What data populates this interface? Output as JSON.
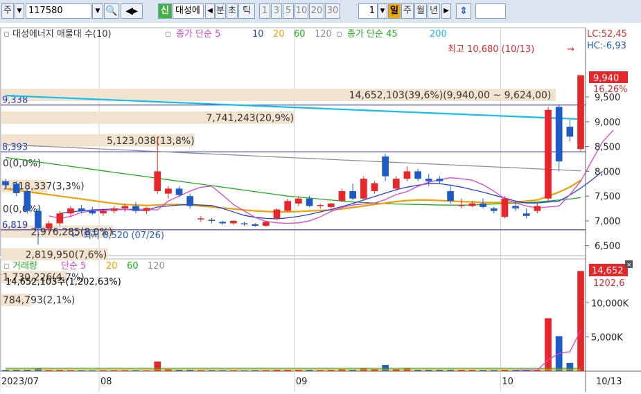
{
  "toolbar": {
    "mode_label": "주",
    "code_value": "117580",
    "new_badge": "신",
    "stock_name": "대성에",
    "period_tick": "분",
    "period_second": "초",
    "period_tick2": "틱",
    "numbers": [
      "1",
      "3",
      "5",
      "10",
      "20",
      "30"
    ],
    "interval_value": "1",
    "day_label": "일",
    "week_label": "주",
    "month_label": "월",
    "year_label": "년"
  },
  "price_panel": {
    "legend_title": "대성에너지 매물대 수(10)",
    "legend_ma1_label": "종가 단순 5",
    "legend_ma1_periods": [
      "10",
      "20",
      "60",
      "120"
    ],
    "legend_ma2_label": "종가 단순 45",
    "legend_ma2_period": "200",
    "right_label_lc": "LC:52,45",
    "right_label_hc": "HC:-6,93",
    "current_price": "9,940",
    "current_change": "16,26%",
    "high_annotation": "최고 10,680 (10/13)",
    "low_annotation": "최저 6,520 (07/26)",
    "left_levels": [
      "9,338",
      "8,393",
      "6,819"
    ],
    "volume_profile": [
      {
        "label": "14,652,103(39,6%)(9,940,00 ~ 9,624,00)",
        "value": 14652103,
        "pct": 39.6
      },
      {
        "label": "7,741,243(20,9%)",
        "value": 7741243,
        "pct": 20.9
      },
      {
        "label": "5,123,038(13,8%)",
        "value": 5123038,
        "pct": 13.8
      },
      {
        "label": "0(0,0%)",
        "value": 0,
        "pct": 0.0
      },
      {
        "label": "1,218,337(3,3%)",
        "value": 1218337,
        "pct": 3.3
      },
      {
        "label": "0(0,0%)",
        "value": 0,
        "pct": 0.0
      },
      {
        "label": "2,976,285(8,0%)",
        "value": 2976285,
        "pct": 8.0
      },
      {
        "label": "2,819,950(7,6%)",
        "value": 2819950,
        "pct": 7.6
      },
      {
        "label": "1,730,226(4,7%)",
        "value": 1730226,
        "pct": 4.7
      },
      {
        "label": "784,793(2,1%)",
        "value": 784793,
        "pct": 2.1
      }
    ]
  },
  "volume_panel": {
    "legend_title": "거래량",
    "legend_ma_label": "단순 5",
    "legend_ma_periods": [
      "20",
      "60",
      "120"
    ],
    "volume_text": "14,652,103주(1,202,63%)",
    "right_value": "14,652",
    "right_pct": "1202,6"
  },
  "colors": {
    "up": "#e8262a",
    "down": "#1f5bc6",
    "ma5": "#e040d0",
    "ma10": "#2040e0",
    "ma20": "#f0a000",
    "ma60": "#18b018",
    "ma120": "#909090",
    "ma200": "#10c0f0",
    "profile": "#f2e3cf",
    "level_line": "#1a1a9a"
  },
  "chart_data": {
    "type": "candlestick",
    "title": "대성에너지 (117580)",
    "ylim": [
      6300,
      10900
    ],
    "y_ticks": [
      6500,
      7000,
      7500,
      8000,
      8500,
      9000,
      9500
    ],
    "y_tick_labels": [
      "6,500",
      "7,000",
      "7,500",
      "8,000",
      "8,500",
      "9,000",
      "9,500"
    ],
    "vol_ticks": [
      5000000,
      10000000
    ],
    "vol_tick_labels": [
      "5,000K",
      "10,000K"
    ],
    "vol_max": 15500000,
    "x_axis_labels": [
      "2023/07",
      "08",
      "09",
      "10",
      "10/13"
    ],
    "x_axis_label_index": [
      0,
      9,
      27,
      46,
      54
    ],
    "h_levels": [
      9338,
      8393,
      6819
    ],
    "ohlc": [
      [
        7800,
        7850,
        7640,
        7720
      ],
      [
        7750,
        7800,
        7500,
        7560
      ],
      [
        7600,
        7650,
        7150,
        7200
      ],
      [
        7200,
        7250,
        6520,
        6850
      ],
      [
        6850,
        7000,
        6780,
        6950
      ],
      [
        6950,
        7200,
        6900,
        7150
      ],
      [
        7150,
        7300,
        7080,
        7250
      ],
      [
        7250,
        7320,
        7150,
        7200
      ],
      [
        7200,
        7280,
        7120,
        7150
      ],
      [
        7150,
        7250,
        7100,
        7200
      ],
      [
        7200,
        7300,
        7150,
        7250
      ],
      [
        7250,
        7350,
        7180,
        7300
      ],
      [
        7300,
        7380,
        7150,
        7200
      ],
      [
        7200,
        7280,
        7140,
        7260
      ],
      [
        7600,
        8700,
        7550,
        8000
      ],
      [
        7550,
        7700,
        7450,
        7650
      ],
      [
        7650,
        7700,
        7480,
        7520
      ],
      [
        7500,
        7550,
        7250,
        7300
      ],
      [
        7050,
        7100,
        6980,
        7050
      ],
      [
        7020,
        7060,
        6950,
        7000
      ],
      [
        6980,
        7000,
        6920,
        6950
      ],
      [
        6950,
        7010,
        6920,
        7000
      ],
      [
        6950,
        6980,
        6900,
        6930
      ],
      [
        6930,
        6960,
        6880,
        6900
      ],
      [
        6900,
        7000,
        6880,
        6980
      ],
      [
        7050,
        7250,
        7020,
        7230
      ],
      [
        7200,
        7450,
        7180,
        7400
      ],
      [
        7350,
        7500,
        7300,
        7450
      ],
      [
        7450,
        7500,
        7280,
        7300
      ],
      [
        7300,
        7350,
        7250,
        7320
      ],
      [
        7280,
        7360,
        7250,
        7350
      ],
      [
        7400,
        7650,
        7380,
        7600
      ],
      [
        7600,
        7750,
        7420,
        7450
      ],
      [
        7450,
        7900,
        7430,
        7850
      ],
      [
        7600,
        7800,
        7550,
        7760
      ],
      [
        8300,
        8350,
        7800,
        7900
      ],
      [
        7650,
        7900,
        7600,
        7850
      ],
      [
        7850,
        8100,
        7800,
        8000
      ],
      [
        8000,
        8050,
        7800,
        7850
      ],
      [
        7850,
        7950,
        7700,
        7800
      ],
      [
        7850,
        7900,
        7750,
        7800
      ],
      [
        7600,
        7700,
        7350,
        7400
      ],
      [
        7300,
        7450,
        7250,
        7320
      ],
      [
        7300,
        7400,
        7280,
        7350
      ],
      [
        7350,
        7450,
        7250,
        7280
      ],
      [
        7250,
        7280,
        7150,
        7200
      ],
      [
        7080,
        7500,
        7050,
        7450
      ],
      [
        7300,
        7400,
        7200,
        7250
      ],
      [
        7150,
        7250,
        7050,
        7100
      ],
      [
        7200,
        7350,
        7150,
        7300
      ],
      [
        7450,
        9300,
        7400,
        9240
      ],
      [
        9300,
        9350,
        8000,
        8200
      ],
      [
        8900,
        9050,
        8600,
        8700
      ],
      [
        8450,
        9150,
        8400,
        9940
      ]
    ],
    "volume": [
      150000,
      160000,
      180000,
      350000,
      120000,
      140000,
      110000,
      100000,
      90000,
      100000,
      110000,
      100000,
      100000,
      90000,
      1400000,
      300000,
      200000,
      150000,
      120000,
      110000,
      100000,
      100000,
      90000,
      100000,
      110000,
      200000,
      250000,
      200000,
      150000,
      120000,
      140000,
      300000,
      250000,
      400000,
      300000,
      900000,
      300000,
      350000,
      250000,
      200000,
      180000,
      220000,
      150000,
      140000,
      130000,
      120000,
      200000,
      130000,
      120000,
      150000,
      7741243,
      5123038,
      1218337,
      14652103
    ],
    "ma_series": [
      {
        "name": "200",
        "color": "#10c0f0",
        "start": 0,
        "values": [
          9530,
          9521,
          9512,
          9503,
          9494,
          9485,
          9476,
          9467,
          9458,
          9449,
          9440,
          9431,
          9422,
          9413,
          9404,
          9395,
          9386,
          9377,
          9368,
          9359,
          9350,
          9341,
          9332,
          9323,
          9314,
          9305,
          9296,
          9287,
          9278,
          9269,
          9260,
          9251,
          9242,
          9233,
          9224,
          9215,
          9206,
          9197,
          9188,
          9179,
          9170,
          9161,
          9152,
          9143,
          9134,
          9125,
          9116,
          9107,
          9098,
          9089,
          9080,
          9071,
          9062,
          9053
        ]
      },
      {
        "name": "120",
        "color": "#909090",
        "start": 0,
        "values": [
          8540,
          8530,
          8520,
          8510,
          8500,
          8490,
          8480,
          8470,
          8460,
          8450,
          8440,
          8430,
          8420,
          8410,
          8400,
          8390,
          8380,
          8370,
          8360,
          8350,
          8340,
          8330,
          8320,
          8310,
          8300,
          8290,
          8280,
          8270,
          8260,
          8250,
          8240,
          8230,
          8220,
          8210,
          8200,
          8190,
          8180,
          8170,
          8160,
          8150,
          8140,
          8130,
          8120,
          8110,
          8100,
          8090,
          8080,
          8070,
          8060,
          8050,
          8040,
          8030,
          8020,
          8010
        ]
      },
      {
        "name": "60",
        "color": "#18b018",
        "start": 0,
        "values": [
          8280,
          8250,
          8220,
          8190,
          8160,
          8130,
          8100,
          8070,
          8040,
          8010,
          7980,
          7950,
          7920,
          7890,
          7860,
          7830,
          7800,
          7770,
          7740,
          7710,
          7680,
          7650,
          7620,
          7590,
          7560,
          7530,
          7500,
          7480,
          7460,
          7440,
          7420,
          7400,
          7380,
          7370,
          7360,
          7350,
          7340,
          7335,
          7330,
          7325,
          7320,
          7318,
          7318,
          7320,
          7330,
          7340,
          7350,
          7360,
          7370,
          7380,
          7400,
          7420,
          7440,
          7470
        ]
      },
      {
        "name": "20",
        "color": "#f0a000",
        "start": 0,
        "values": [
          7650,
          7620,
          7590,
          7560,
          7530,
          7500,
          7470,
          7440,
          7410,
          7380,
          7350,
          7330,
          7320,
          7310,
          7320,
          7330,
          7330,
          7320,
          7300,
          7280,
          7260,
          7240,
          7220,
          7200,
          7190,
          7180,
          7180,
          7190,
          7200,
          7210,
          7220,
          7240,
          7270,
          7300,
          7330,
          7360,
          7390,
          7410,
          7420,
          7420,
          7410,
          7400,
          7390,
          7380,
          7370,
          7370,
          7370,
          7380,
          7400,
          7420,
          7500,
          7580,
          7680,
          7820
        ]
      },
      {
        "name": "10",
        "color": "#2040e0",
        "start": 5,
        "values": [
          7150,
          7180,
          7200,
          7220,
          7230,
          7240,
          7230,
          7220,
          7210,
          7280,
          7300,
          7320,
          7330,
          7320,
          7310,
          7250,
          7180,
          7110,
          7070,
          7050,
          7040,
          7060,
          7090,
          7130,
          7180,
          7230,
          7290,
          7350,
          7420,
          7490,
          7560,
          7630,
          7680,
          7720,
          7750,
          7750,
          7720,
          7680,
          7630,
          7580,
          7520,
          7460,
          7400,
          7360,
          7360,
          7380,
          7400,
          7520,
          7660,
          7820,
          8000
        ]
      },
      {
        "name": "5",
        "color": "#e040d0",
        "start": 4,
        "values": [
          7100,
          7050,
          7090,
          7170,
          7200,
          7210,
          7220,
          7230,
          7240,
          7230,
          7220,
          7400,
          7500,
          7600,
          7680,
          7700,
          7520,
          7330,
          7200,
          7070,
          6990,
          6960,
          6950,
          6960,
          7000,
          7080,
          7190,
          7270,
          7320,
          7340,
          7360,
          7430,
          7530,
          7590,
          7700,
          7780,
          7830,
          7870,
          7850,
          7820,
          7730,
          7600,
          7450,
          7360,
          7300,
          7260,
          7280,
          7300,
          7530,
          7800,
          8200,
          8590,
          8830
        ]
      }
    ],
    "vol_ma5": [
      [
        47,
        150000
      ],
      [
        48,
        160000
      ],
      [
        49,
        170000
      ],
      [
        50,
        1650000
      ],
      [
        51,
        2600000
      ],
      [
        52,
        2850000
      ],
      [
        53,
        6000000
      ]
    ]
  }
}
